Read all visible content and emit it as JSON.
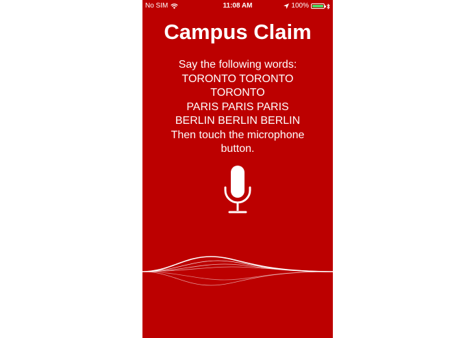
{
  "status_bar": {
    "carrier": "No SIM",
    "time": "11:08 AM",
    "battery_percent": "100%",
    "battery_level": 1.0,
    "battery_color": "#4cd964",
    "wifi_icon": "wifi-icon",
    "location_icon": "location-arrow-icon",
    "bluetooth_icon": "bluetooth-icon"
  },
  "app": {
    "title": "Campus Claim",
    "background_color": "#bc0000"
  },
  "instructions": {
    "lines": [
      "Say the following words:",
      "TORONTO TORONTO",
      "TORONTO",
      "PARIS PARIS PARIS",
      "BERLIN BERLIN BERLIN",
      "Then touch the microphone",
      "button."
    ]
  },
  "microphone": {
    "icon": "microphone-icon"
  },
  "waveform": {
    "icon": "audio-waveform"
  }
}
